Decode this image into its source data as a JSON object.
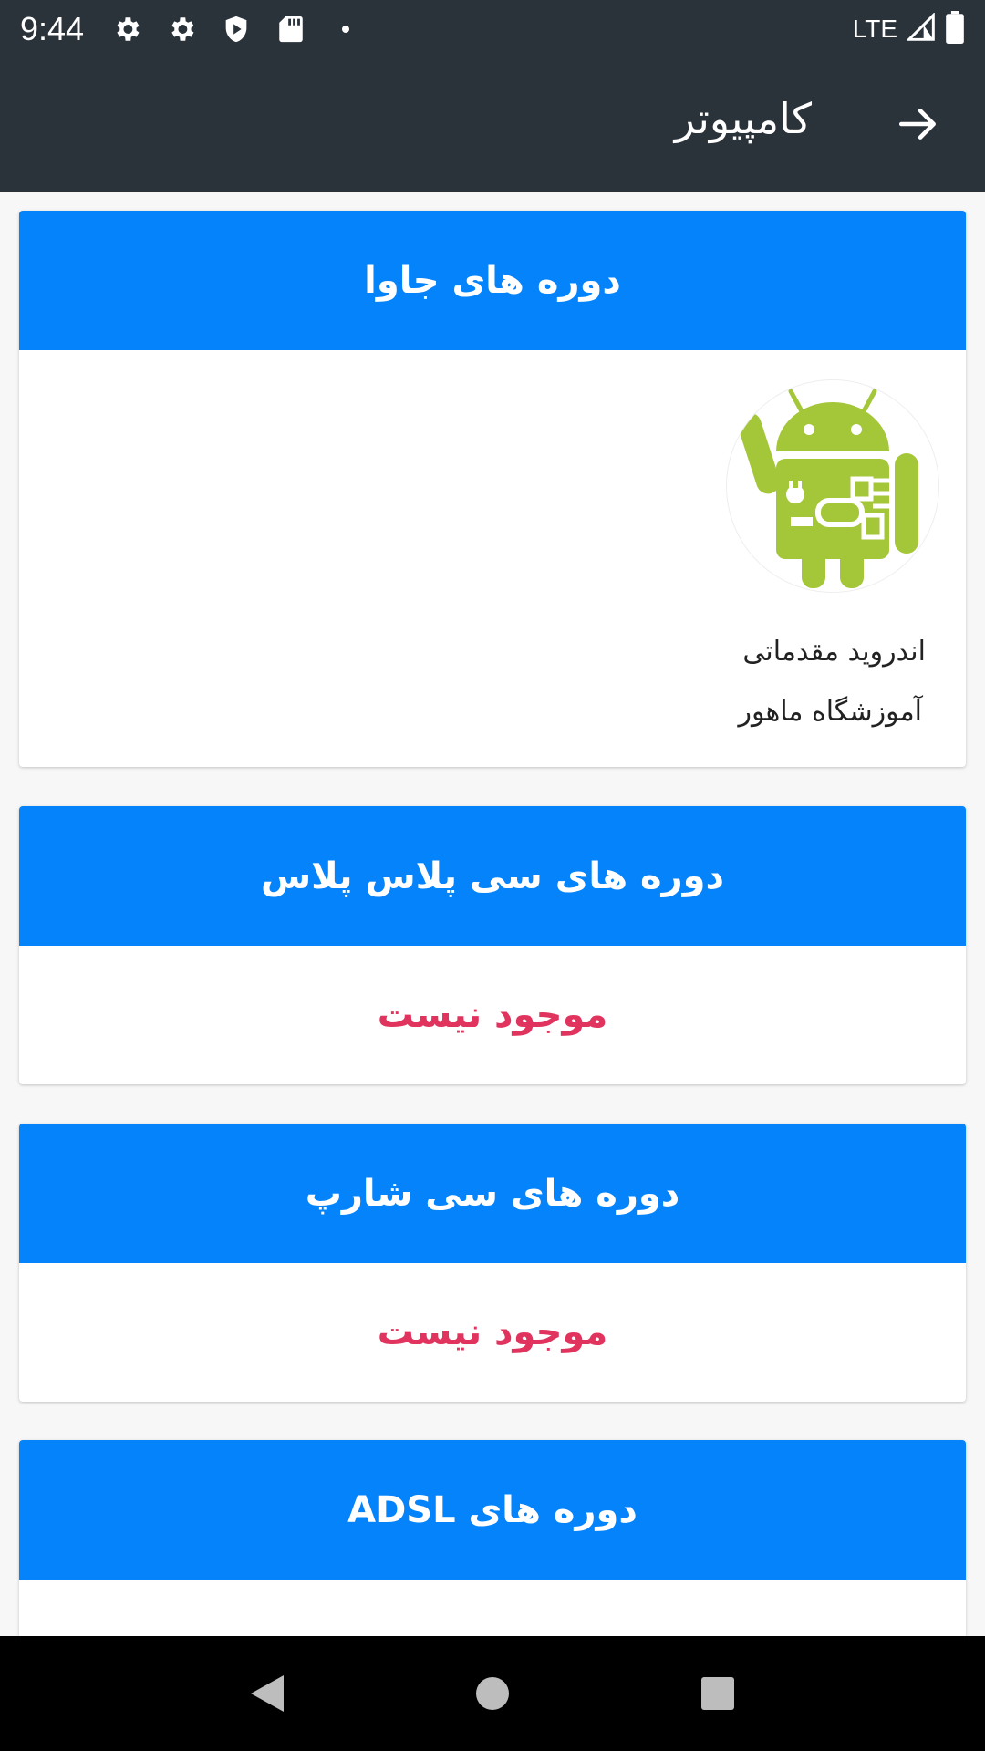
{
  "status_bar": {
    "time": "9:44",
    "network": "LTE",
    "icons": [
      "gear-icon",
      "gear-icon",
      "shield-play-icon",
      "sd-card-icon",
      "dot-icon",
      "signal-icon",
      "battery-icon"
    ]
  },
  "app_bar": {
    "title": "کامپیوتر",
    "back_icon": "arrow-right-icon"
  },
  "sections": [
    {
      "title": "دوره های جاوا",
      "courses": [
        {
          "title": "اندروید مقدماتی",
          "school": "آموزشگاه ماهور",
          "image": "android-icon"
        }
      ]
    },
    {
      "title": "دوره های سی پلاس پلاس",
      "empty_text": "موجود نیست"
    },
    {
      "title": "دوره های سی شارپ",
      "empty_text": "موجود نیست"
    },
    {
      "title": "دوره های ADSL"
    }
  ],
  "colors": {
    "app_bar": "#2a323a",
    "section_header": "#0483fb",
    "empty_text": "#e0345e",
    "android_green": "#a4c639"
  },
  "nav_bar": {
    "buttons": [
      "back-triangle-icon",
      "home-circle-icon",
      "recents-square-icon"
    ]
  }
}
